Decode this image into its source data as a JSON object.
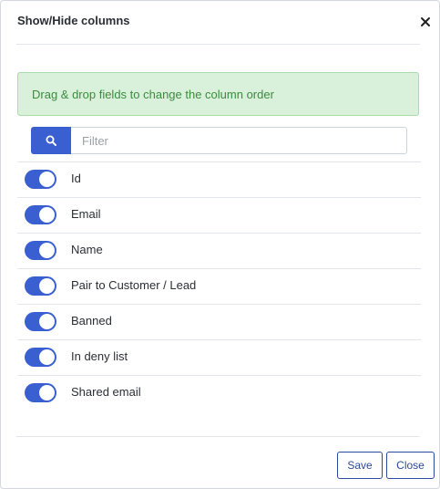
{
  "modal": {
    "title": "Show/Hide columns",
    "close_icon": "close-icon"
  },
  "info": {
    "text": "Drag & drop fields to change the column order"
  },
  "filter": {
    "placeholder": "Filter",
    "value": "",
    "icon": "search-icon"
  },
  "columns": [
    {
      "label": "Id",
      "enabled": true
    },
    {
      "label": "Email",
      "enabled": true
    },
    {
      "label": "Name",
      "enabled": true
    },
    {
      "label": "Pair to Customer / Lead",
      "enabled": true
    },
    {
      "label": "Banned",
      "enabled": true
    },
    {
      "label": "In deny list",
      "enabled": true
    },
    {
      "label": "Shared email",
      "enabled": true
    }
  ],
  "footer": {
    "save_label": "Save",
    "close_label": "Close"
  },
  "colors": {
    "accent": "#3a5fd1",
    "info_bg": "#d9f0da",
    "info_text": "#3b8c3f",
    "button_border": "#2a4a9c"
  }
}
